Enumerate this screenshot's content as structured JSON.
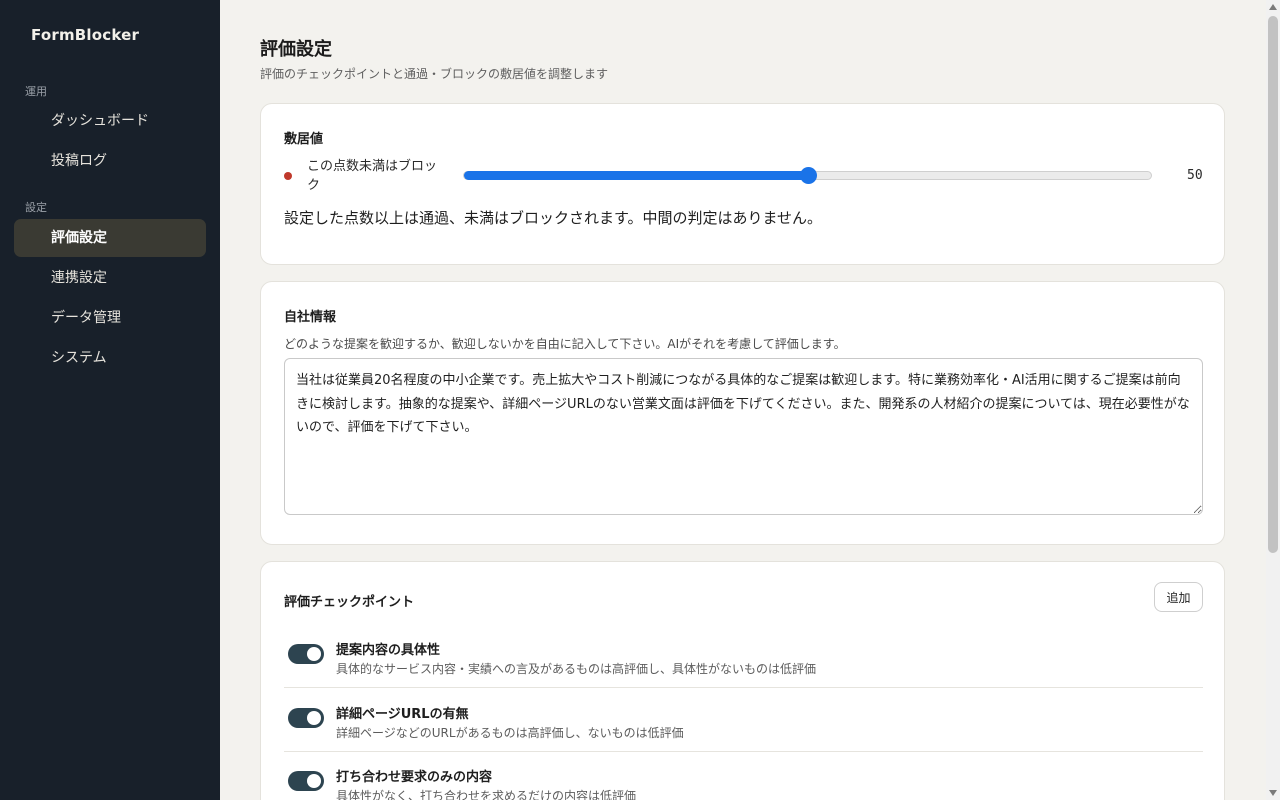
{
  "sidebar": {
    "brand": "FormBlocker",
    "sections": [
      {
        "label": "運用",
        "items": [
          {
            "label": "ダッシュボード"
          },
          {
            "label": "投稿ログ"
          }
        ]
      },
      {
        "label": "設定",
        "items": [
          {
            "label": "評価設定",
            "active": true
          },
          {
            "label": "連携設定"
          },
          {
            "label": "データ管理"
          },
          {
            "label": "システム"
          }
        ]
      }
    ]
  },
  "page": {
    "title": "評価設定",
    "subtitle": "評価のチェックポイントと通過・ブロックの敷居値を調整します"
  },
  "threshold": {
    "title": "敷居値",
    "slider_label": "この点数未満はブロック",
    "value": 50,
    "min": 0,
    "max": 100,
    "value_text": "50",
    "note": "設定した点数以上は通過、未満はブロックされます。中間の判定はありません。",
    "accent": "#1a73e8",
    "dot_color": "#c0392b"
  },
  "company": {
    "title": "自社情報",
    "description": "どのような提案を歓迎するか、歓迎しないかを自由に記入して下さい。AIがそれを考慮して評価します。",
    "text": "当社は従業員20名程度の中小企業です。売上拡大やコスト削減につながる具体的なご提案は歓迎します。特に業務効率化・AI活用に関するご提案は前向きに検討します。抽象的な提案や、詳細ページURLのない営業文面は評価を下げてください。また、開発系の人材紹介の提案については、現在必要性がないので、評価を下げて下さい。"
  },
  "checkpoints": {
    "title": "評価チェックポイント",
    "add_label": "追加",
    "items": [
      {
        "title": "提案内容の具体性",
        "description": "具体的なサービス内容・実績への言及があるものは高評価し、具体性がないものは低評価",
        "enabled": true
      },
      {
        "title": "詳細ページURLの有無",
        "description": "詳細ページなどのURLがあるものは高評価し、ないものは低評価",
        "enabled": true
      },
      {
        "title": "打ち合わせ要求のみの内容",
        "description": "具体性がなく、打ち合わせを求めるだけの内容は低評価",
        "enabled": true
      }
    ]
  }
}
